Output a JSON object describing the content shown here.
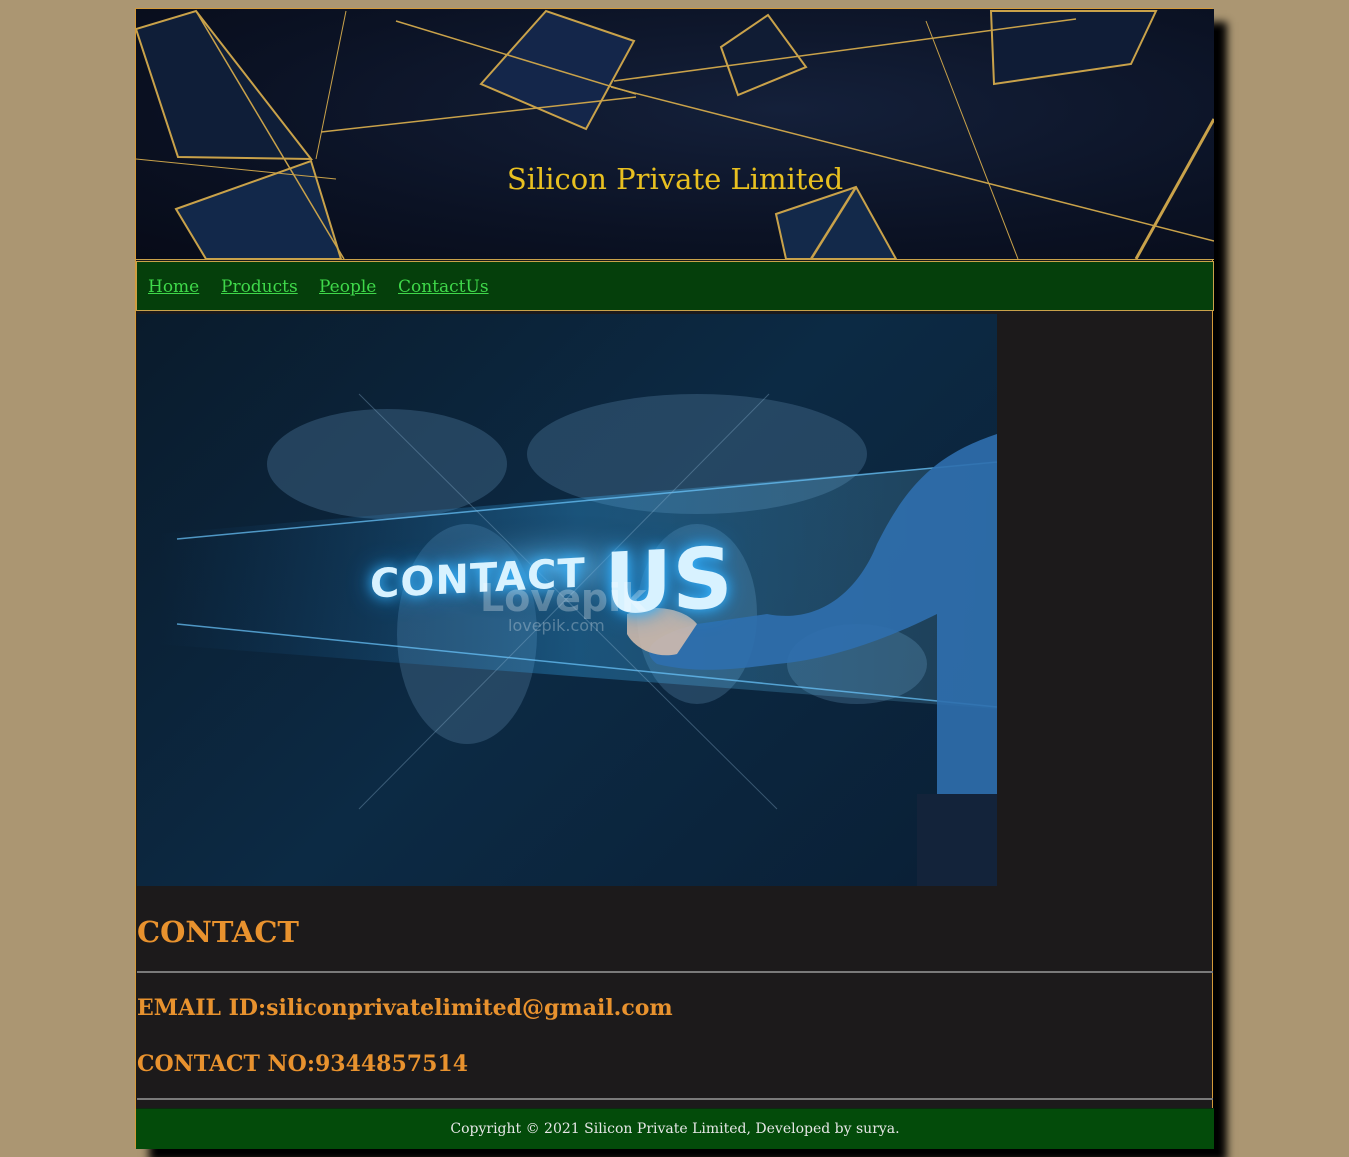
{
  "header": {
    "title": "Silicon Private Limited"
  },
  "nav": {
    "items": [
      {
        "label": "Home"
      },
      {
        "label": "Products"
      },
      {
        "label": "People"
      },
      {
        "label": "ContactUs"
      }
    ]
  },
  "banner": {
    "word1": "CONTACT",
    "word2": "US",
    "watermark": "Lovepik",
    "watermark_url": "lovepik.com"
  },
  "content": {
    "heading": "CONTACT",
    "email_line": "EMAIL ID:siliconprivatelimited@gmail.com",
    "phone_line": "CONTACT NO:9344857514"
  },
  "footer": {
    "text": "Copyright © 2021 Silicon Private Limited, Developed by surya."
  },
  "colors": {
    "background": "#ab9672",
    "nav_bg": "#053f0b",
    "nav_link": "#3fd84a",
    "title": "#e8c020",
    "content_text": "#e8922e",
    "content_bg": "#1c1a1b",
    "footer_bg": "#034b0a"
  }
}
